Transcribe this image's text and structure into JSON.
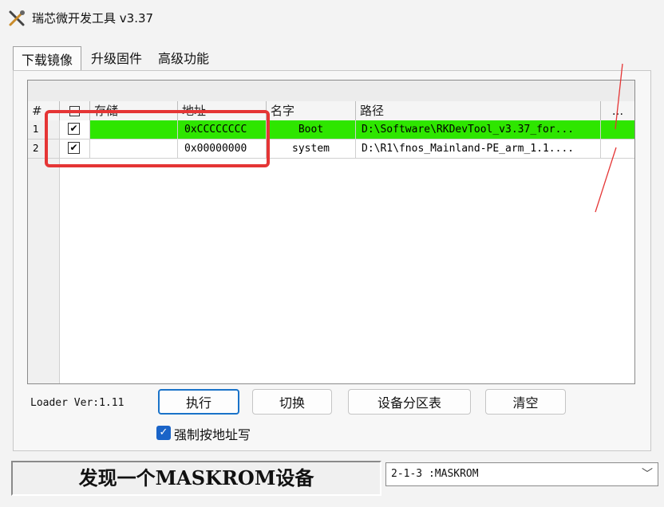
{
  "window": {
    "title": "瑞芯微开发工具 v3.37",
    "icon": "tools-icon"
  },
  "tabs": [
    {
      "label": "下载镜像",
      "active": true
    },
    {
      "label": "升级固件",
      "active": false
    },
    {
      "label": "高级功能",
      "active": false
    }
  ],
  "table": {
    "columns": [
      "#",
      "存储",
      "地址",
      "名字",
      "路径",
      "..."
    ],
    "rows": [
      {
        "num": "1",
        "checked": true,
        "storage": "",
        "address": "0xCCCCCCCC",
        "name": "Boot",
        "path": "D:\\Software\\RKDevTool_v3.37_for...",
        "more": "",
        "selected": true
      },
      {
        "num": "2",
        "checked": true,
        "storage": "",
        "address": "0x00000000",
        "name": "system",
        "path": "D:\\R1\\fnos_Mainland-PE_arm_1.1....",
        "more": "",
        "selected": false
      }
    ],
    "selected_row_color": "#2ee600"
  },
  "loader_version": "Loader Ver:1.11",
  "buttons": {
    "execute": "执行",
    "switch": "切换",
    "partition_table": "设备分区表",
    "clear": "清空"
  },
  "force_address_write": {
    "label": "强制按地址写",
    "checked": true
  },
  "status_text": "发现一个MASKROM设备",
  "device_select": {
    "value": "2-1-3 :MASKROM"
  },
  "annotation_color": "#e53535"
}
